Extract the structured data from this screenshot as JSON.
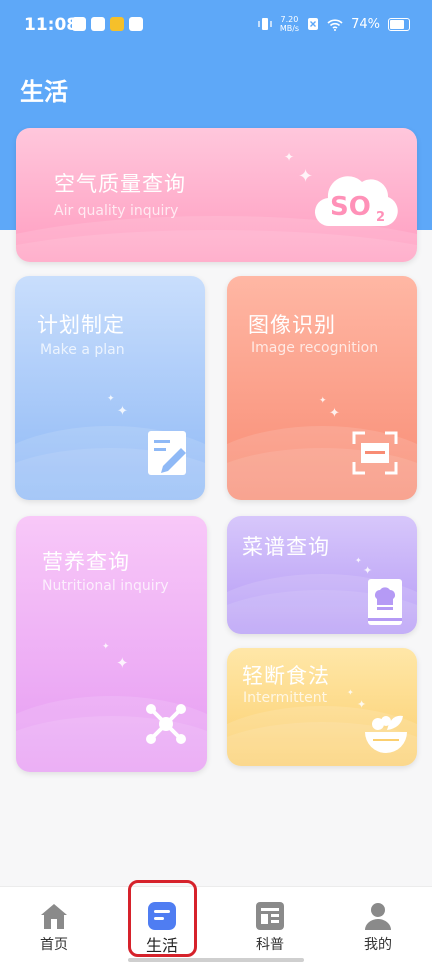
{
  "status_bar": {
    "time": "11:08",
    "net_speed_value": "7.20",
    "net_speed_unit": "MB/s",
    "battery": "74%"
  },
  "page": {
    "title": "生活"
  },
  "cards": {
    "air": {
      "title": "空气质量查询",
      "subtitle": "Air quality inquiry",
      "badge": "SO",
      "badge_sub": "2"
    },
    "plan": {
      "title": "计划制定",
      "subtitle": "Make a plan"
    },
    "image": {
      "title": "图像识别",
      "subtitle": "Image recognition"
    },
    "nutrition": {
      "title": "营养查询",
      "subtitle": "Nutritional inquiry"
    },
    "recipe": {
      "title": "菜谱查询"
    },
    "fasting": {
      "title": "轻断食法",
      "subtitle": "Intermittent"
    }
  },
  "bottom_nav": {
    "items": [
      {
        "label": "首页",
        "icon": "home-icon"
      },
      {
        "label": "生活",
        "icon": "life-icon",
        "active": true
      },
      {
        "label": "科普",
        "icon": "article-icon"
      },
      {
        "label": "我的",
        "icon": "user-icon"
      }
    ]
  },
  "colors": {
    "header_blue": "#5ea8f8",
    "active_nav": "#4f7df2",
    "inactive_nav": "#8a8a8a",
    "highlight_red": "#d6222b"
  }
}
